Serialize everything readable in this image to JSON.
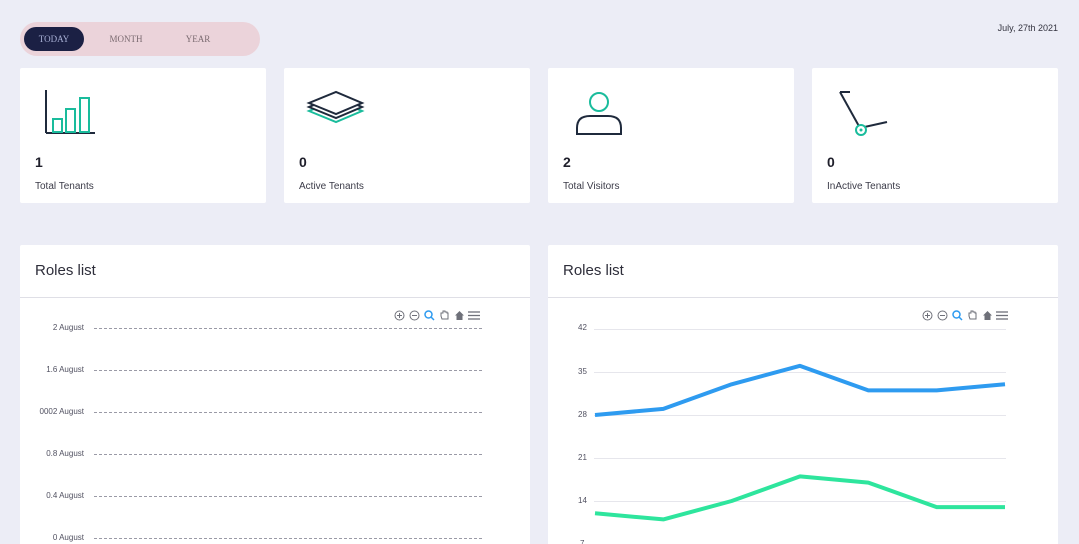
{
  "period_tabs": [
    {
      "label": "TODAY",
      "active": true
    },
    {
      "label": "MONTH",
      "active": false
    },
    {
      "label": "YEAR",
      "active": false
    }
  ],
  "date": "July, 27th 2021",
  "stats": [
    {
      "value": "1",
      "label": "Total Tenants",
      "icon": "bar-chart-icon"
    },
    {
      "value": "0",
      "label": "Active Tenants",
      "icon": "layers-icon"
    },
    {
      "value": "2",
      "label": "Total Visitors",
      "icon": "user-icon"
    },
    {
      "value": "0",
      "label": "InActive Tenants",
      "icon": "share-icon"
    }
  ],
  "panels": {
    "left": {
      "title": "Roles list"
    },
    "right": {
      "title": "Roles list"
    }
  },
  "toolbar_icons": [
    "zoom-in-icon",
    "zoom-out-icon",
    "zoom-selection-icon",
    "pan-hand-icon",
    "reset-home-icon",
    "menu-icon"
  ],
  "colors": {
    "accent": "#1b2044",
    "teal": "#1abc9c",
    "blue": "#2e9bf0",
    "green": "#2ee59d"
  },
  "chart_data": [
    {
      "type": "line",
      "title": "",
      "y_ticks": [
        "2 August",
        "1.6 August",
        "0002 August",
        "0.8 August",
        "0.4 August",
        "0 August"
      ],
      "series": []
    },
    {
      "type": "line",
      "title": "",
      "y_ticks": [
        "42",
        "35",
        "28",
        "21",
        "14",
        "7"
      ],
      "ylim": [
        7,
        42
      ],
      "series": [
        {
          "values": [
            28,
            29,
            33,
            36,
            32,
            32,
            33
          ],
          "color": "#2e9bf0"
        },
        {
          "values": [
            12,
            11,
            14,
            18,
            17,
            13,
            13
          ],
          "color": "#2ee59d"
        }
      ]
    }
  ]
}
